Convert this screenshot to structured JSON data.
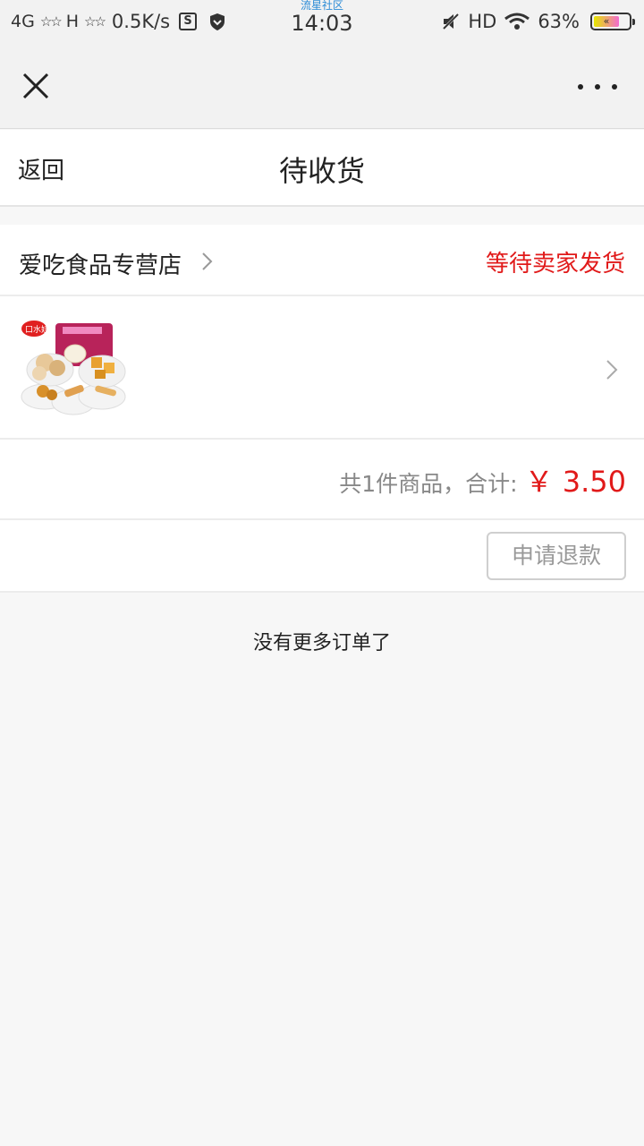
{
  "status_bar": {
    "network_left": "4G",
    "network_right": "H",
    "stars": "☆☆",
    "speed": "0.5K/s",
    "carrier": "流星社区",
    "time": "14:03",
    "hd": "HD",
    "battery_percent": "63%",
    "battery_level": 0.63
  },
  "topbar": {
    "close_icon": "close-icon",
    "more_icon": "more-icon"
  },
  "header": {
    "back_label": "返回",
    "title": "待收货"
  },
  "order": {
    "shop_name": "爱吃食品专营店",
    "status": "等待卖家发货",
    "summary_label": "共1件商品，合计:",
    "total_price": "￥ 3.50",
    "refund_button": "申请退款"
  },
  "footer": {
    "no_more": "没有更多订单了"
  },
  "colors": {
    "accent_red": "#e11a1a",
    "background": "#f7f7f7",
    "carrier_blue": "#2a8bd6"
  }
}
